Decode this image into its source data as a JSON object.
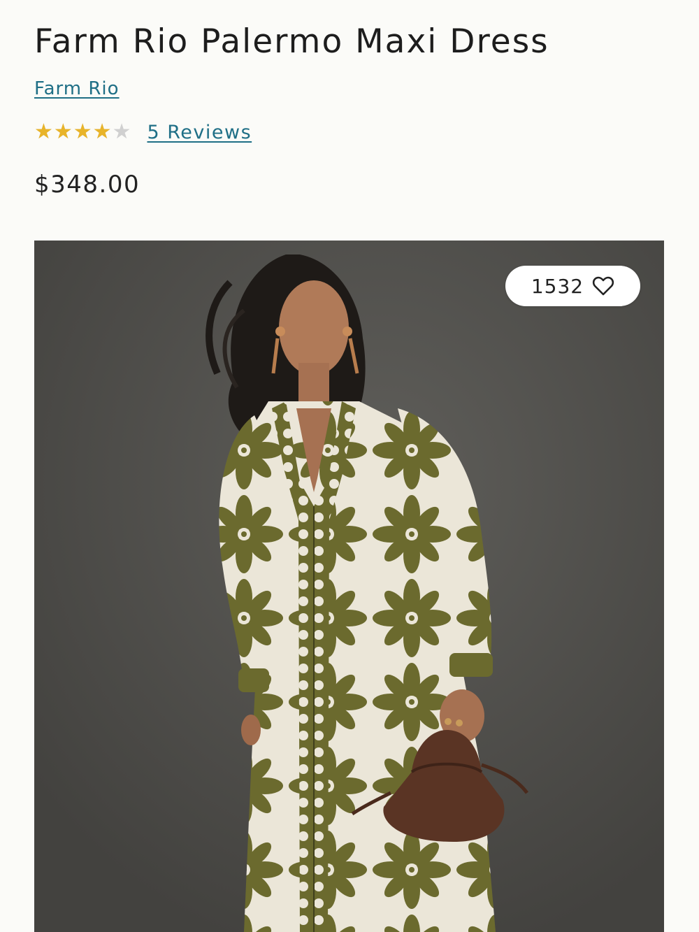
{
  "product": {
    "title": "Farm Rio Palermo Maxi Dress",
    "brand": "Farm Rio",
    "rating": 4,
    "rating_max": 5,
    "reviews_label": "5 Reviews",
    "price": "$348.00"
  },
  "image": {
    "like_count": "1532",
    "like_icon": "heart-outline-icon"
  },
  "colors": {
    "link": "#1f6f86",
    "star": "#e8b42a",
    "star_empty": "#d0d0d0",
    "background": "#fbfbf8",
    "dress_olive": "#6b6a2e",
    "dress_cream": "#eee9dc",
    "photo_backdrop": "#4c4b48"
  }
}
